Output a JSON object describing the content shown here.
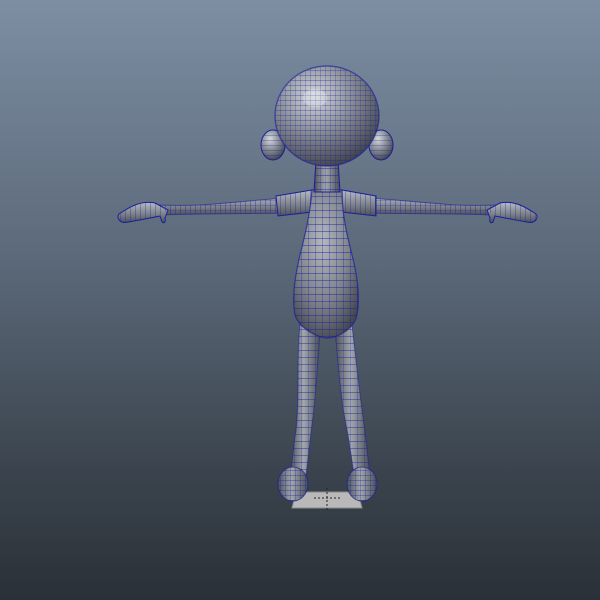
{
  "viewport": {
    "background_top": "#7d8ea3",
    "background_bottom": "#2a3037"
  },
  "model": {
    "shading": "smooth-shaded-with-wireframe",
    "pose": "T-pose",
    "view": "front",
    "surface_color": "#9aa0a8",
    "wireframe_color": "#1a1f9c"
  },
  "ground_marker": {
    "color": "#b9b9b9"
  }
}
